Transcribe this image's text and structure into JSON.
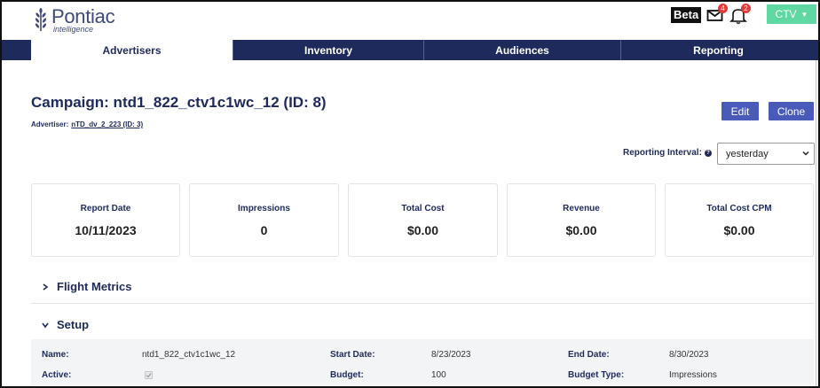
{
  "header": {
    "logo_name": "Pontiac",
    "logo_sub": "intelligence",
    "beta_label": "Beta",
    "mail_badge": "4",
    "notif_badge": "2",
    "ctv_label": "CTV",
    "accent_color": "#5fd8a4"
  },
  "nav": {
    "tabs": [
      {
        "label": "Advertisers",
        "active": true
      },
      {
        "label": "Inventory",
        "active": false
      },
      {
        "label": "Audiences",
        "active": false
      },
      {
        "label": "Reporting",
        "active": false
      }
    ],
    "bar_color": "#1f2a5c"
  },
  "campaign": {
    "title": "Campaign: ntd1_822_ctv1c1wc_12 (ID: 8)",
    "advertiser_label": "Advertiser:",
    "advertiser_link": "nTD_dv_2_223 (ID: 3)",
    "edit_label": "Edit",
    "clone_label": "Clone",
    "button_color": "#4a5ab8"
  },
  "reporting": {
    "label": "Reporting Interval:",
    "help_glyph": "?",
    "selected": "yesterday"
  },
  "metrics": [
    {
      "label": "Report Date",
      "value": "10/11/2023"
    },
    {
      "label": "Impressions",
      "value": "0"
    },
    {
      "label": "Total Cost",
      "value": "$0.00"
    },
    {
      "label": "Revenue",
      "value": "$0.00"
    },
    {
      "label": "Total Cost CPM",
      "value": "$0.00"
    }
  ],
  "sections": {
    "flight_metrics": "Flight Metrics",
    "setup": "Setup"
  },
  "setup": {
    "name_label": "Name:",
    "name_value": "ntd1_822_ctv1c1wc_12",
    "active_label": "Active:",
    "active_checked": true,
    "start_date_label": "Start Date:",
    "start_date_value": "8/23/2023",
    "budget_label": "Budget:",
    "budget_value": "100",
    "end_date_label": "End Date:",
    "end_date_value": "8/30/2023",
    "budget_type_label": "Budget Type:",
    "budget_type_value": "Impressions"
  }
}
